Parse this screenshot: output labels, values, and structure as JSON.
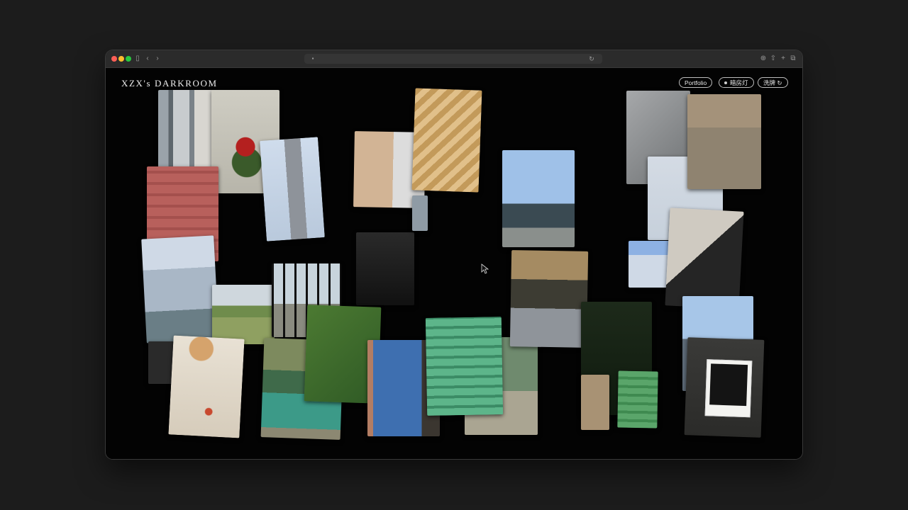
{
  "site": {
    "logo": "XZX's DARKROOM",
    "nav": {
      "portfolio": "Portfolio",
      "darkroom_light": "暗房灯",
      "develop": "洗牌",
      "develop_icon": "refresh-icon"
    }
  },
  "browser": {
    "traffic_lights": [
      "close",
      "minimize",
      "zoom"
    ],
    "icons": [
      "sidebar-icon",
      "back-icon",
      "forward-icon",
      "shield-icon",
      "lock-icon",
      "reload-icon",
      "share-icon",
      "new-tab-icon",
      "tabs-icon"
    ]
  },
  "colors": {
    "background": "#030303",
    "outer_background": "#1c1c1c",
    "text": "#ececec"
  }
}
